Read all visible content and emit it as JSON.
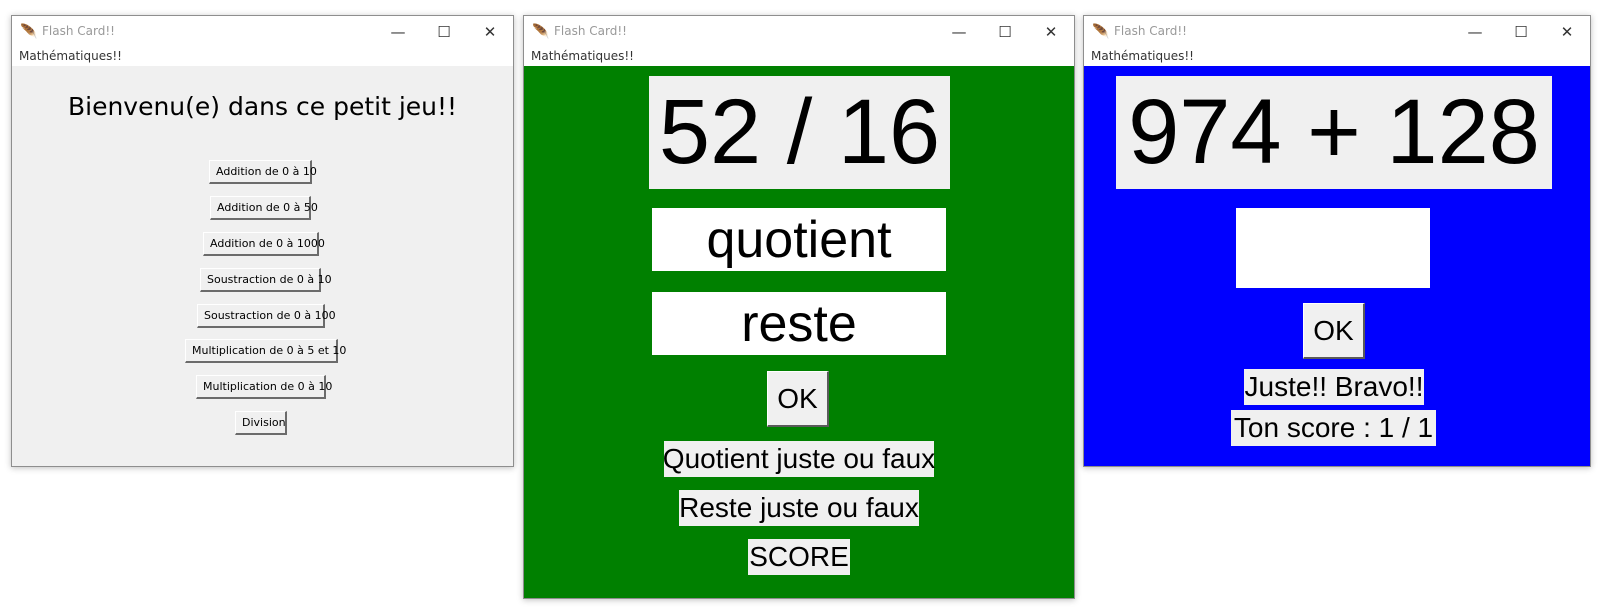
{
  "windows": [
    {
      "title": "Flash Card!!",
      "menu": "Mathématiques!!",
      "welcome": "Bienvenu(e) dans ce petit jeu!!",
      "buttons": [
        "Addition de 0 à 10",
        "Addition de 0 à 50",
        "Addition de 0 à 1000",
        "Soustraction de 0 à 10",
        "Soustraction de 0 à 100",
        "Multiplication de 0 à 5 et 10",
        "Multiplication de 0 à 10",
        "Division"
      ]
    },
    {
      "title": "Flash Card!!",
      "menu": "Mathématiques!!",
      "background": "#008000",
      "problem": "52 / 16",
      "quotient_value": "quotient",
      "remainder_value": "reste",
      "ok_label": "OK",
      "quotient_feedback": "Quotient juste ou faux",
      "remainder_feedback": "Reste juste ou faux",
      "score": "SCORE"
    },
    {
      "title": "Flash Card!!",
      "menu": "Mathématiques!!",
      "background": "#0000ff",
      "problem": "974 + 128",
      "answer_value": "",
      "ok_label": "OK",
      "feedback": "Juste!! Bravo!!",
      "score": "Ton score : 1 / 1"
    }
  ],
  "icons": {
    "app": "feather-icon",
    "minimize": "minimize-icon",
    "maximize": "maximize-icon",
    "close": "close-icon"
  }
}
